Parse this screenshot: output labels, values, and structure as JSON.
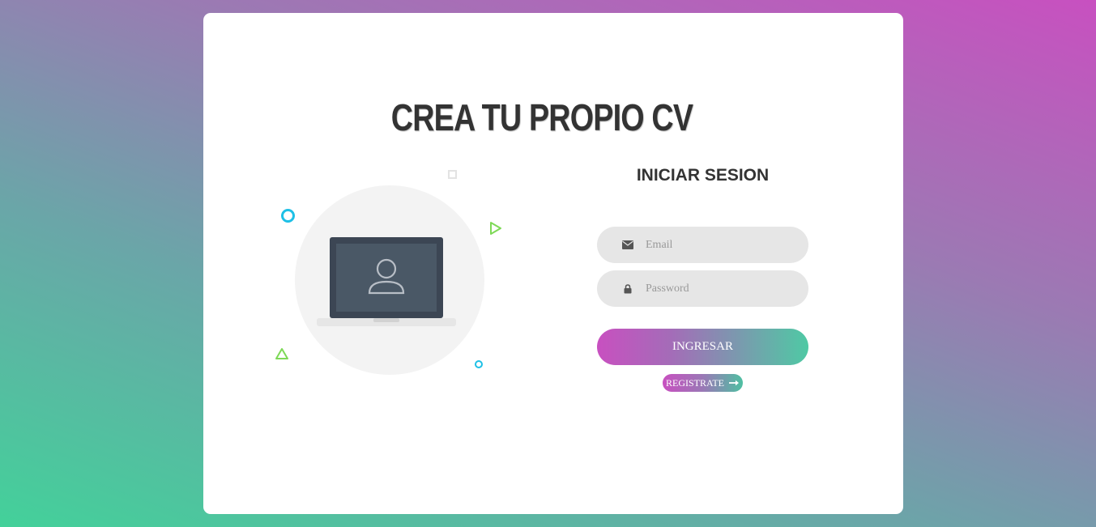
{
  "header": {
    "title": "CREA TU PROPIO CV"
  },
  "illustration": {
    "icon": "laptop-user-icon",
    "decorations": [
      "circle-outline-icon",
      "square-outline-icon",
      "play-triangle-icon",
      "triangle-outline-icon",
      "small-circle-outline-icon"
    ]
  },
  "login": {
    "heading": "INICIAR SESION",
    "email": {
      "placeholder": "Email",
      "value": "",
      "icon": "envelope-icon"
    },
    "password": {
      "placeholder": "Password",
      "value": "",
      "icon": "lock-icon"
    },
    "submit_label": "INGRESAR",
    "register_label": "REGISTRATE",
    "register_icon": "arrow-right-icon"
  },
  "colors": {
    "accent_pink": "#c850c0",
    "accent_green": "#43d19a",
    "cyan_deco": "#1ec0e6",
    "green_deco": "#7ed957",
    "laptop_dark": "#3c4654",
    "text_dark": "#333333"
  }
}
